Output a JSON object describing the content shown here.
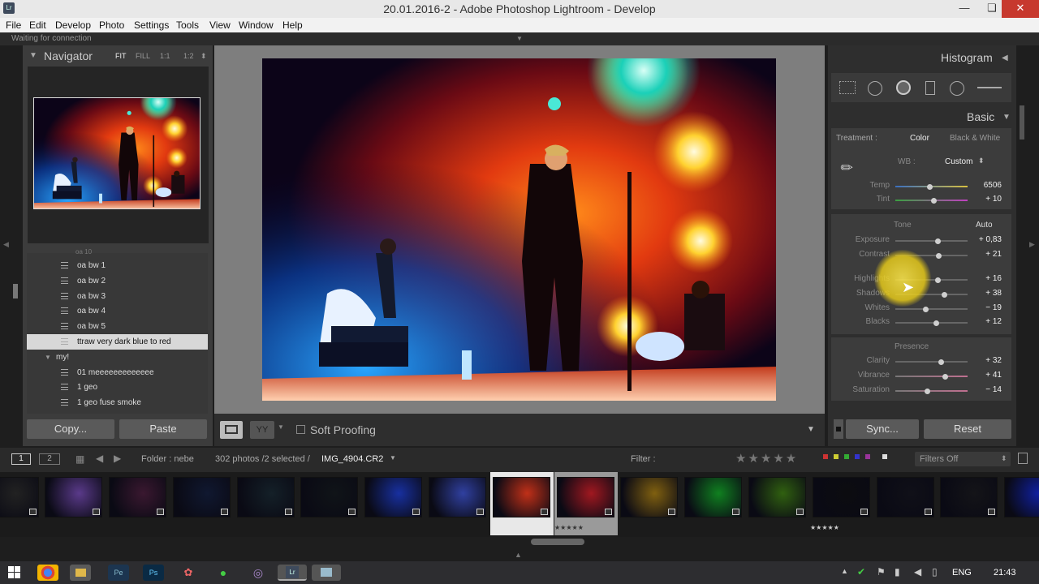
{
  "window": {
    "title": "20.01.2016-2 - Adobe Photoshop Lightroom - Develop",
    "logo": "Lr",
    "minimize": "—",
    "restore": "❏",
    "close": "✕"
  },
  "menu": [
    "File",
    "Edit",
    "Develop",
    "Photo",
    "Settings",
    "Tools",
    "View",
    "Window",
    "Help"
  ],
  "status": "Waiting for connection",
  "navigator": {
    "title": "Navigator",
    "zoom": [
      "FIT",
      "FILL",
      "1:1",
      "1:2"
    ]
  },
  "presets": {
    "items": [
      {
        "label": "oa bw 1",
        "type": "preset"
      },
      {
        "label": "oa bw 2",
        "type": "preset"
      },
      {
        "label": "oa bw 3",
        "type": "preset"
      },
      {
        "label": "oa bw 4",
        "type": "preset"
      },
      {
        "label": "oa bw 5",
        "type": "preset"
      },
      {
        "label": "ttraw very dark blue to red",
        "type": "preset",
        "selected": true
      },
      {
        "label": "my!",
        "type": "folder"
      },
      {
        "label": "01 meeeeeeeeeeeee",
        "type": "preset"
      },
      {
        "label": "1 geo",
        "type": "preset"
      },
      {
        "label": "1 geo  fuse smoke",
        "type": "preset"
      }
    ]
  },
  "left_buttons": {
    "copy": "Copy...",
    "paste": "Paste"
  },
  "toolbar": {
    "soft_proofing": "Soft Proofing"
  },
  "right": {
    "histogram": "Histogram",
    "basic": "Basic",
    "treatment_label": "Treatment :",
    "treatment_color": "Color",
    "treatment_bw": "Black & White",
    "wb_label": "WB :",
    "wb_value": "Custom",
    "tone": "Tone",
    "auto": "Auto",
    "presence": "Presence",
    "sliders": [
      {
        "label": "Temp",
        "value": "6506",
        "pos": 0.47
      },
      {
        "label": "Tint",
        "value": "+ 10",
        "pos": 0.53
      },
      {
        "label": "Exposure",
        "value": "+ 0,83",
        "pos": 0.58
      },
      {
        "label": "Contrast",
        "value": "+ 21",
        "pos": 0.6
      },
      {
        "label": "Highlights",
        "value": "+ 16",
        "pos": 0.58
      },
      {
        "label": "Shadows",
        "value": "+ 38",
        "pos": 0.67
      },
      {
        "label": "Whites",
        "value": "− 19",
        "pos": 0.42
      },
      {
        "label": "Blacks",
        "value": "+ 12",
        "pos": 0.56
      },
      {
        "label": "Clarity",
        "value": "+ 32",
        "pos": 0.63
      },
      {
        "label": "Vibrance",
        "value": "+ 41",
        "pos": 0.68
      },
      {
        "label": "Saturation",
        "value": "− 14",
        "pos": 0.44
      }
    ],
    "sync": "Sync...",
    "reset": "Reset"
  },
  "filmbar": {
    "page1": "1",
    "page2": "2",
    "folder": "Folder : nebe",
    "count": "302 photos /2 selected /",
    "filename": "IMG_4904.CR2",
    "filter_label": "Filter :",
    "filters_off": "Filters Off"
  },
  "filmstrip": {
    "ratings": [
      "★★★★★",
      "★★★★★"
    ]
  },
  "taskbar": {
    "lang": "ENG",
    "time": "21:43"
  },
  "colors": {
    "panel": "#3c3c3c",
    "accent_close": "#c7392e"
  }
}
